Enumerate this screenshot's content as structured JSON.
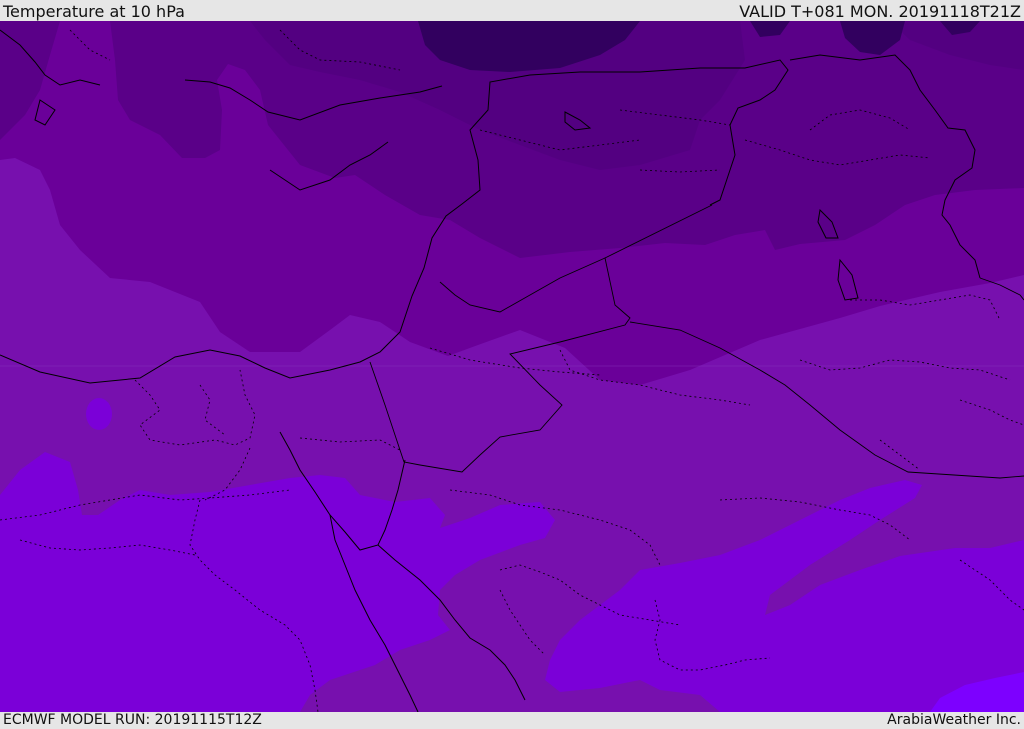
{
  "header": {
    "title": "Temperature at 10 hPa",
    "valid": "VALID T+081 MON. 20191118T21Z"
  },
  "footer": {
    "model_run": "ECMWF MODEL RUN: 20191115T12Z",
    "credit": "ArabiaWeather Inc."
  },
  "colors": {
    "darkest": "#32005f",
    "very_dark": "#4b007a",
    "dark": "#5a0088",
    "mid_dark": "#6a0099",
    "mid": "#7710ae",
    "light": "#7b00d8",
    "lightest": "#7d00ff",
    "boundary": "#000000"
  }
}
